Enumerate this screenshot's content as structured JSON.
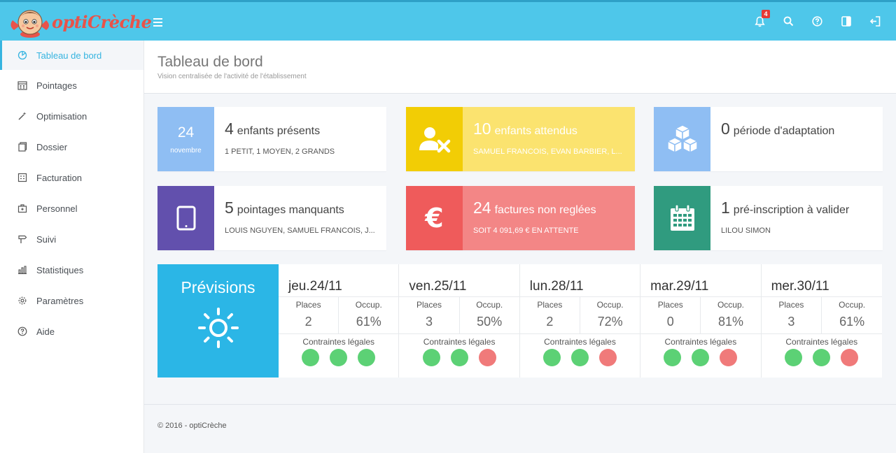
{
  "header": {
    "logo_text": "optiCrèche",
    "notification_count": "4"
  },
  "sidebar": {
    "items": [
      {
        "label": "Tableau de bord"
      },
      {
        "label": "Pointages"
      },
      {
        "label": "Optimisation"
      },
      {
        "label": "Dossier"
      },
      {
        "label": "Facturation"
      },
      {
        "label": "Personnel"
      },
      {
        "label": "Suivi"
      },
      {
        "label": "Statistiques"
      },
      {
        "label": "Paramètres"
      },
      {
        "label": "Aide"
      }
    ]
  },
  "page": {
    "title": "Tableau de bord",
    "subtitle": "Vision centralisée de l'activité de l'établissement"
  },
  "cards": {
    "presents": {
      "day": "24",
      "month": "novembre",
      "num": "4",
      "label": "enfants présents",
      "sub": "1 PETIT, 1 MOYEN, 2 GRANDS"
    },
    "attendus": {
      "num": "10",
      "label": "enfants attendus",
      "sub": "SAMUEL FRANCOIS, EVAN BARBIER, L..."
    },
    "adaptation": {
      "num": "0",
      "label": "période d'adaptation",
      "sub": ""
    },
    "pointages": {
      "num": "5",
      "label": "pointages manquants",
      "sub": "LOUIS NGUYEN, SAMUEL FRANCOIS, J..."
    },
    "factures": {
      "num": "24",
      "label": "factures non reglées",
      "sub": "SOIT 4 091,69 € EN ATTENTE"
    },
    "preinscription": {
      "num": "1",
      "label": "pré-inscription à valider",
      "sub": "LILOU SIMON"
    }
  },
  "forecast": {
    "title": "Prévisions",
    "places_label": "Places",
    "occup_label": "Occup.",
    "legal_label": "Contraintes légales",
    "days": [
      {
        "date": "jeu.24/11",
        "places": "2",
        "occup": "61%",
        "legal": [
          "ok",
          "ok",
          "ok"
        ]
      },
      {
        "date": "ven.25/11",
        "places": "3",
        "occup": "50%",
        "legal": [
          "ok",
          "ok",
          "ko"
        ]
      },
      {
        "date": "lun.28/11",
        "places": "2",
        "occup": "72%",
        "legal": [
          "ok",
          "ok",
          "ko"
        ]
      },
      {
        "date": "mar.29/11",
        "places": "0",
        "occup": "81%",
        "legal": [
          "ok",
          "ok",
          "ko"
        ]
      },
      {
        "date": "mer.30/11",
        "places": "3",
        "occup": "61%",
        "legal": [
          "ok",
          "ok",
          "ko"
        ]
      }
    ]
  },
  "colors": {
    "header": "#4ec7ea",
    "accent": "#36b4e0",
    "ok": "#5cd175",
    "ko": "#f07a7a",
    "blue_light": "#8fbef3",
    "yellow_dark": "#f2cd05",
    "yellow_light": "#fbe36f",
    "purple": "#6250ad",
    "red_dark": "#ef5b5b",
    "red_light": "#f38686",
    "teal": "#309b7f",
    "forecast_blue": "#2bb6e6"
  },
  "footer": {
    "text": "© 2016 - optiCrèche"
  }
}
